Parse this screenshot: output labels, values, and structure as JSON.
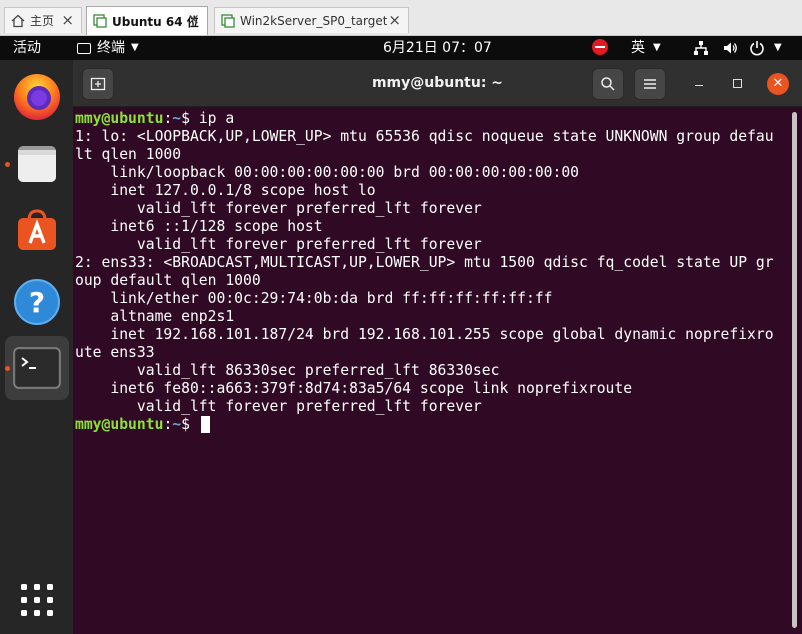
{
  "vm_tabs": [
    {
      "label": "主页",
      "icon": "home-icon"
    },
    {
      "label": "Ubuntu 64 位",
      "icon": "vm-icon",
      "active": true
    },
    {
      "label": "Win2kServer_SP0_target",
      "icon": "vm-icon"
    }
  ],
  "topbar": {
    "activities": "活动",
    "app_menu": "终端",
    "clock": "6月21日  07：07",
    "input_method": "英"
  },
  "dock": {
    "items": [
      "firefox-icon",
      "files-icon",
      "software-icon",
      "help-icon",
      "terminal-icon"
    ],
    "show_apps": "grid-icon",
    "accent": "#e95420"
  },
  "terminal": {
    "title": "mmy@ubuntu: ~",
    "colors": {
      "background": "#300a24",
      "prompt_user": "#8ae234",
      "prompt_path": "#729fcf"
    },
    "prompt": {
      "user": "mmy@ubuntu",
      "sep": ":",
      "path": "~",
      "symbol": "$ "
    },
    "command": "ip a",
    "output": [
      "1: lo: <LOOPBACK,UP,LOWER_UP> mtu 65536 qdisc noqueue state UNKNOWN group defau",
      "lt qlen 1000",
      "    link/loopback 00:00:00:00:00:00 brd 00:00:00:00:00:00",
      "    inet 127.0.0.1/8 scope host lo",
      "       valid_lft forever preferred_lft forever",
      "    inet6 ::1/128 scope host",
      "       valid_lft forever preferred_lft forever",
      "2: ens33: <BROADCAST,MULTICAST,UP,LOWER_UP> mtu 1500 qdisc fq_codel state UP gr",
      "oup default qlen 1000",
      "    link/ether 00:0c:29:74:0b:da brd ff:ff:ff:ff:ff:ff",
      "    altname enp2s1",
      "    inet 192.168.101.187/24 brd 192.168.101.255 scope global dynamic noprefixro",
      "ute ens33",
      "       valid_lft 86330sec preferred_lft 86330sec",
      "    inet6 fe80::a663:379f:8d74:83a5/64 scope link noprefixroute",
      "       valid_lft forever preferred_lft forever"
    ]
  }
}
